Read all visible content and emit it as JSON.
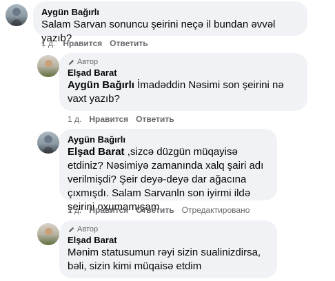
{
  "comments": [
    {
      "author": "Aygün Bağırlı",
      "author_tag": "",
      "mention": "",
      "text": "Salam Sarvan sonuncu şeirini neçə il bundan əvvəl yazıb?",
      "time": "1 д.",
      "like": "Нравится",
      "reply": "Ответить",
      "edited": ""
    },
    {
      "author": "Elşad Barat",
      "author_tag": "Автор",
      "mention": "Aygün Bağırlı",
      "text": "İmadəddin Nəsimi son şeirini nə vaxt yazıb?",
      "time": "1 д.",
      "like": "Нравится",
      "reply": "Ответить",
      "edited": ""
    },
    {
      "author": "Aygün Bağırlı",
      "author_tag": "",
      "mention": "Elşad Barat",
      "text": ",sizcə düzgün müqayisə etdiniz? Nəsimiyə zamanında xalq şairi adı verilmişdi? Şeir deyə-deyə dar ağacına çıxmışdı. Salam Sarvanln son iyirmi ildə şeirini oxumamışam.",
      "time": "1 д.",
      "like": "Нравится",
      "reply": "Ответить",
      "edited": "Отредактировано"
    },
    {
      "author": "Elşad Barat",
      "author_tag": "Автор",
      "mention": "",
      "text": "Mənim statusumun rəyi sizin sualinizdirsa, bəli, sizin kimi müqaisə etdim",
      "time": "",
      "like": "",
      "reply": "",
      "edited": ""
    }
  ]
}
